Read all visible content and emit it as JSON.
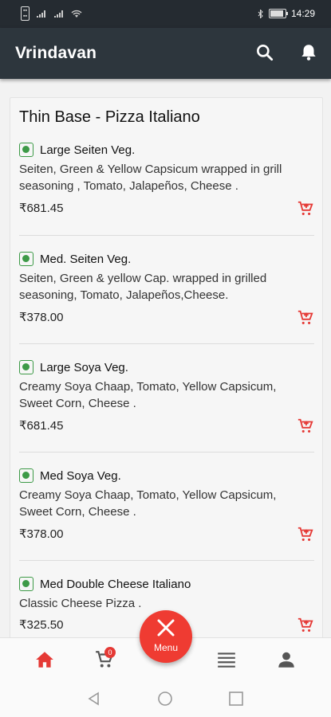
{
  "status": {
    "left_icons": [
      "sim-icon",
      "signal-icon",
      "signal-icon",
      "wifi-icon"
    ],
    "right_icons": [
      "bluetooth-icon",
      "battery-icon"
    ],
    "battery_level": 0.87,
    "battery_text": "87",
    "time": "14:29"
  },
  "appbar": {
    "title": "Vrindavan",
    "icons": [
      "search-icon",
      "bell-icon"
    ]
  },
  "section": {
    "title": "Thin Base - Pizza Italiano"
  },
  "items": [
    {
      "name": "Large Seiten Veg.",
      "desc": "Seiten, Green & Yellow Capsicum wrapped in grill seasoning , Tomato, Jalapeños, Cheese .",
      "price": "₹681.45"
    },
    {
      "name": "Med. Seiten Veg.",
      "desc": "Seiten, Green & yellow Cap. wrapped in grilled seasoning, Tomato, Jalapeños,Cheese.",
      "price": "₹378.00"
    },
    {
      "name": "Large Soya Veg.",
      "desc": "Creamy Soya Chaap, Tomato, Yellow Capsicum, Sweet Corn, Cheese .",
      "price": "₹681.45"
    },
    {
      "name": "Med Soya Veg.",
      "desc": "Creamy Soya Chaap, Tomato, Yellow Capsicum, Sweet Corn, Cheese .",
      "price": "₹378.00"
    },
    {
      "name": "Med Double Cheese Italiano",
      "desc": "Classic Cheese Pizza .",
      "price": "₹325.50"
    }
  ],
  "bottom_nav": {
    "items": [
      "home-icon",
      "cart-icon",
      "list-icon",
      "profile-icon"
    ],
    "cart_badge": "0",
    "fab_label": "Menu"
  },
  "colors": {
    "appbar": "#2d363d",
    "accent": "#ef3b32",
    "veg": "#3d9a47"
  }
}
